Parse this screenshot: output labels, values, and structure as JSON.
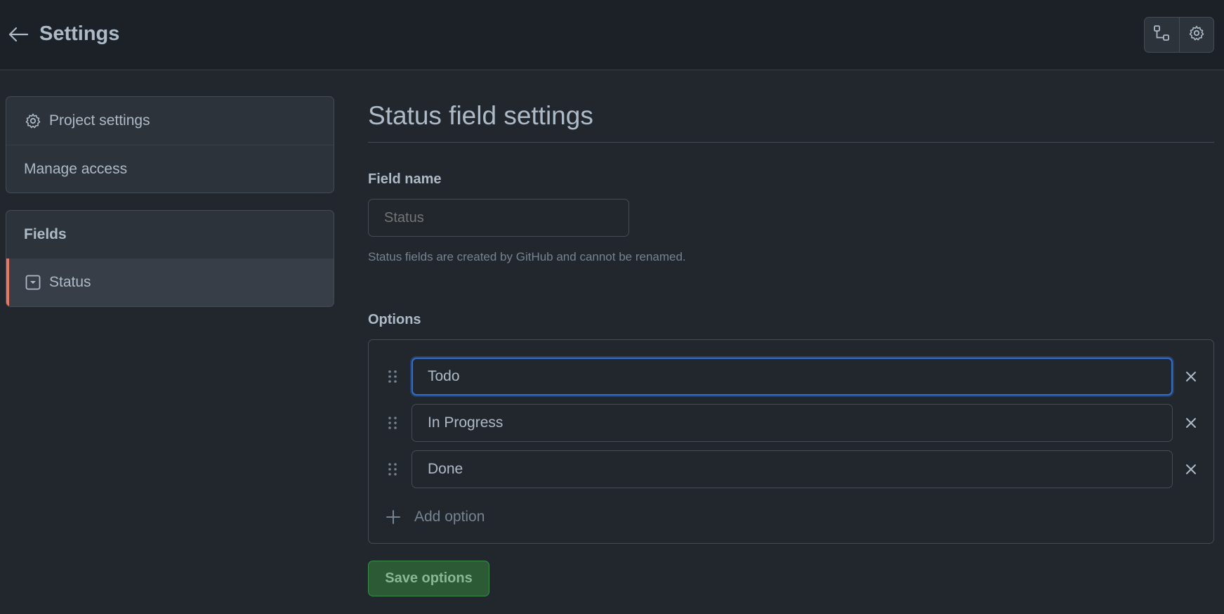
{
  "header": {
    "title": "Settings"
  },
  "sidebar": {
    "general": {
      "items": [
        {
          "label": "Project settings"
        },
        {
          "label": "Manage access"
        }
      ]
    },
    "fields": {
      "heading": "Fields",
      "items": [
        {
          "label": "Status",
          "selected": true
        }
      ]
    }
  },
  "main": {
    "title": "Status field settings",
    "field_name": {
      "label": "Field name",
      "placeholder": "Status",
      "hint": "Status fields are created by GitHub and cannot be renamed."
    },
    "options": {
      "label": "Options",
      "items": [
        {
          "value": "Todo"
        },
        {
          "value": "In Progress"
        },
        {
          "value": "Done"
        }
      ],
      "add_label": "Add option"
    },
    "save_label": "Save options"
  },
  "colors": {
    "accent": "#ec775c",
    "focus": "#316dca",
    "save": "#2b5a34"
  }
}
